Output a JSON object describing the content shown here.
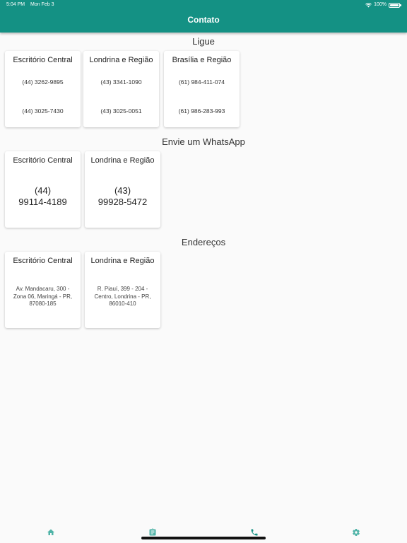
{
  "status_bar": {
    "time": "5:04 PM",
    "date": "Mon Feb 3",
    "battery": "100%"
  },
  "header": {
    "title": "Contato"
  },
  "colors": {
    "primary": "#149184",
    "background": "#fafafa",
    "card": "#ffffff"
  },
  "sections": {
    "call": {
      "title": "Ligue",
      "cards": [
        {
          "title": "Escritório Central",
          "phones": [
            "(44) 3262-9895",
            "(44) 3025-7430"
          ]
        },
        {
          "title": "Londrina e Região",
          "phones": [
            "(43) 3341-1090",
            "(43) 3025-0051"
          ]
        },
        {
          "title": "Brasília e Região",
          "phones": [
            "(61) 984-411-074",
            "(61) 986-283-993"
          ]
        }
      ]
    },
    "whatsapp": {
      "title": "Envie um WhatsApp",
      "cards": [
        {
          "title": "Escritório Central",
          "area": "(44)",
          "number": "99114-4189"
        },
        {
          "title": "Londrina e Região",
          "area": "(43)",
          "number": "99928-5472"
        }
      ]
    },
    "addresses": {
      "title": "Endereços",
      "cards": [
        {
          "title": "Escritório Central",
          "lines": [
            "Av. Mandacaru, 300 -",
            "Zona 06, Maringá - PR,",
            "87080-185"
          ]
        },
        {
          "title": "Londrina e Região",
          "lines": [
            "R. Piauí, 399 - 204 -",
            "Centro, Londrina - PR,",
            "86010-410"
          ]
        }
      ]
    }
  },
  "bottom_nav": {
    "items": [
      {
        "icon": "home-icon",
        "active": false
      },
      {
        "icon": "clipboard-icon",
        "active": false
      },
      {
        "icon": "phone-icon",
        "active": true
      },
      {
        "icon": "gear-icon",
        "active": false
      }
    ]
  }
}
